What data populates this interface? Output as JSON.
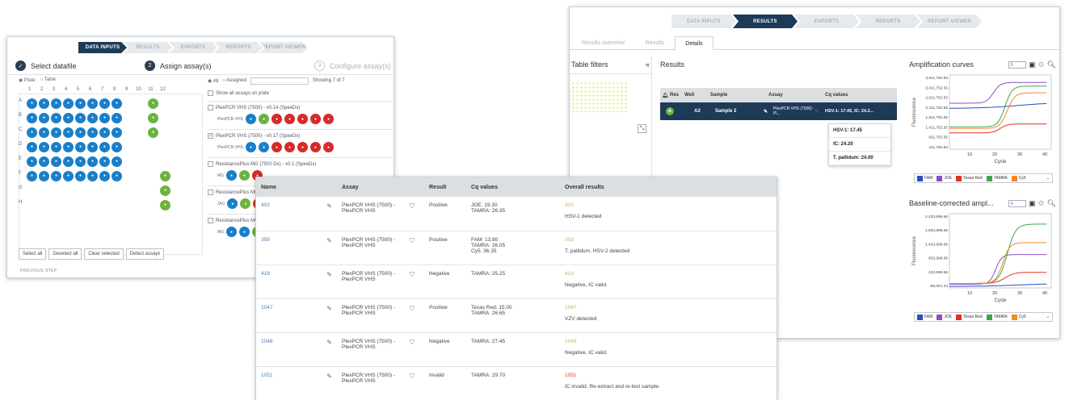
{
  "assign_window": {
    "steps": [
      "DATA INPUTS",
      "RESULTS",
      "EXPORTS",
      "REPORTS",
      "REPORT VIEWER"
    ],
    "active_step": 0,
    "wizard": [
      {
        "num": "✓",
        "label": "Select datafile"
      },
      {
        "num": "2",
        "label": "Assign assay(s)"
      },
      {
        "num": "3",
        "label": "Configure assay(s)"
      }
    ],
    "plate_tabs": [
      "Plate",
      "Table"
    ],
    "columns": [
      "1",
      "2",
      "3",
      "4",
      "5",
      "6",
      "7",
      "8",
      "9",
      "10",
      "11",
      "12"
    ],
    "rows": [
      "A",
      "B",
      "C",
      "D",
      "E",
      "F",
      "G",
      "H"
    ],
    "wells": [
      [
        "b",
        "b",
        "b",
        "b",
        "b",
        "b",
        "b",
        "b",
        "e",
        "e",
        "g",
        "e"
      ],
      [
        "b",
        "b",
        "b",
        "b",
        "b",
        "b",
        "b",
        "b",
        "e",
        "e",
        "g",
        "e"
      ],
      [
        "b",
        "b",
        "b",
        "b",
        "b",
        "b",
        "b",
        "b",
        "e",
        "e",
        "g",
        "e"
      ],
      [
        "b",
        "b",
        "b",
        "b",
        "b",
        "b",
        "b",
        "b",
        "e",
        "e",
        "e",
        "e"
      ],
      [
        "b",
        "b",
        "b",
        "b",
        "b",
        "b",
        "b",
        "b",
        "e",
        "e",
        "e",
        "e"
      ],
      [
        "b",
        "b",
        "b",
        "b",
        "b",
        "b",
        "b",
        "b",
        "e",
        "e",
        "e",
        "g"
      ],
      [
        "e",
        "e",
        "e",
        "e",
        "e",
        "e",
        "e",
        "e",
        "e",
        "e",
        "e",
        "g"
      ],
      [
        "e",
        "e",
        "e",
        "e",
        "e",
        "e",
        "e",
        "e",
        "e",
        "e",
        "e",
        "g"
      ]
    ],
    "filter_all": "All",
    "filter_assigned": "Assigned",
    "showing": "Showing 7 of 7",
    "show_all": "Show all assays on plate",
    "assays": [
      {
        "name": "PlexPCR VHS (7500) - v0.14 (SpeeDx)",
        "checked": false,
        "dots_label": "PlexPCR VHS",
        "dots": [
          "b",
          "g",
          "r",
          "r",
          "r",
          "r",
          "r"
        ]
      },
      {
        "name": "PlexPCR VHS (7500) - v0.17 (SpeeDx)",
        "checked": true,
        "dots_label": "PlexPCR VHS",
        "dots": [
          "b",
          "b",
          "r",
          "r",
          "r",
          "r",
          "r"
        ]
      },
      {
        "name": "ResistancePlus MG (7500 Dx) - v0.1 (SpeeDx)",
        "checked": false,
        "dots_label": "MG",
        "dots": [
          "b",
          "g",
          "r"
        ]
      },
      {
        "name": "ResistancePlus MG",
        "checked": false,
        "dots_label": "JAC",
        "dots": [
          "b",
          "g",
          "r"
        ]
      },
      {
        "name": "ResistancePlus MG",
        "checked": false,
        "dots_label": "MG",
        "dots": [
          "b",
          "b",
          "g"
        ]
      }
    ],
    "buttons": [
      "Select all",
      "Deselect all",
      "Clear selected",
      "Detect assays"
    ],
    "previous_step": "PREVIOUS STEP"
  },
  "results_window": {
    "steps": [
      "DATA INPUTS",
      "RESULTS",
      "EXPORTS",
      "REPORTS",
      "REPORT VIEWER"
    ],
    "active_step": 1,
    "tabs": [
      "Results overview",
      "Results",
      "Details"
    ],
    "active_tab": 2,
    "filters_title": "Table filters",
    "collapse_icon": "«",
    "results_title": "Results",
    "table_headers": [
      "Res",
      "Well",
      "Sample",
      "Assay",
      "Cq values"
    ],
    "row": {
      "well": "A2",
      "sample": "Sample 2",
      "assay": "PlexPCR VHS (7500) - Pl...",
      "cq": "HSV-1: 17.45, IC: 24.2..."
    },
    "cq_popup": [
      "HSV-1: 17.45",
      "IC: 24.20",
      "T. pallidum: 24.00"
    ],
    "charts": [
      {
        "title": "Amplification curves",
        "ylabel": "Fluorescence",
        "xlabel": "Cycle",
        "yticks": [
          "3,911,752.55",
          "3,411,752.55",
          "2,911,752.55",
          "2,411,752.55",
          "1,911,752.55",
          "1,411,752.55",
          "911,752.55",
          "411,752.55"
        ],
        "xticks": [
          "10",
          "20",
          "30",
          "40"
        ],
        "select": "F"
      },
      {
        "title": "Baseline-corrected ampl...",
        "ylabel": "Fluorescence",
        "xlabel": "Cycle",
        "yticks": [
          "2,433,998.66",
          "1,933,998.66",
          "1,433,998.66",
          "933,998.66",
          "433,998.66",
          "-66,001.34"
        ],
        "xticks": [
          "10",
          "20",
          "30",
          "40"
        ],
        "select": "F"
      }
    ],
    "legend": [
      {
        "name": "FAM",
        "color": "#2a4fb8"
      },
      {
        "name": "JOE",
        "color": "#8a4fc7"
      },
      {
        "name": "Texas Red",
        "color": "#e0302a"
      },
      {
        "name": "TAMRA",
        "color": "#3aa74a"
      },
      {
        "name": "Cy5",
        "color": "#f08a24"
      }
    ]
  },
  "table_window": {
    "headers": [
      "Name",
      "Assay",
      "Result",
      "Cq values",
      "Overall results"
    ],
    "rows": [
      {
        "name": "403",
        "assay": "PlexPCR VHS (7500) - PlexPCR VHS",
        "result": "Positive",
        "cq": "JOE: 19.30\nTAMRA: 26.35",
        "ov_num": "403",
        "ov_txt": "HSV-1 detected",
        "bad": false
      },
      {
        "name": "358",
        "assay": "PlexPCR VHS (7500) - PlexPCR VHS",
        "result": "Positive",
        "cq": "FAM: 13.80\nTAMRA: 26.05\nCy5: 36.35",
        "ov_num": "358",
        "ov_txt": "T. pallidum, HSV-2 detected",
        "bad": false
      },
      {
        "name": "419",
        "assay": "PlexPCR VHS (7500) - PlexPCR VHS",
        "result": "Negative",
        "cq": "TAMRA: 25.25",
        "ov_num": "419",
        "ov_txt": "Negative, IC valid.",
        "bad": false
      },
      {
        "name": "1047",
        "assay": "PlexPCR VHS (7500) - PlexPCR VHS",
        "result": "Positive",
        "cq": "Texas Red: 15.00\nTAMRA: 26.65",
        "ov_num": "1047",
        "ov_txt": "VZV detected",
        "bad": false
      },
      {
        "name": "1048",
        "assay": "PlexPCR VHS (7500) - PlexPCR VHS",
        "result": "Negative",
        "cq": "TAMRA: 27.45",
        "ov_num": "1048",
        "ov_txt": "Negative, IC valid.",
        "bad": false
      },
      {
        "name": "1051",
        "assay": "PlexPCR VHS (7500) - PlexPCR VHS",
        "result": "Invalid",
        "cq": "TAMRA: 29.70",
        "ov_num": "1051",
        "ov_txt": "IC invalid. Re-extract and re-test sample.",
        "bad": true
      }
    ]
  }
}
